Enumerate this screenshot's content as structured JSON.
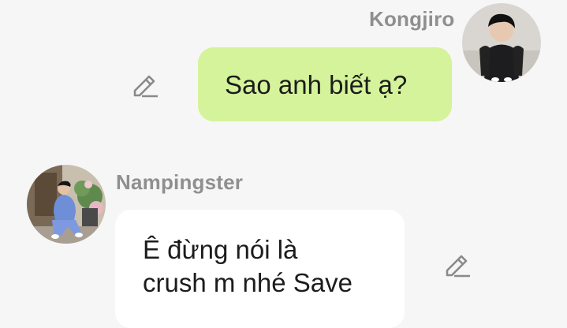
{
  "messages": [
    {
      "sender": "Kongjiro",
      "text": "Sao anh biết ạ?",
      "side": "right",
      "bubble_color": "#d5f39a",
      "avatar_icon": "user-avatar-kongjiro",
      "edit_icon": "pencil-icon"
    },
    {
      "sender": "Nampingster",
      "text_lines": [
        "Ê đừng nói là",
        "crush m nhé Save"
      ],
      "side": "left",
      "bubble_color": "#ffffff",
      "avatar_icon": "user-avatar-nampingster",
      "edit_icon": "pencil-icon"
    }
  ],
  "colors": {
    "background": "#f6f6f6",
    "sender_name": "#8f8f8f",
    "icon": "#8a8a8a"
  }
}
